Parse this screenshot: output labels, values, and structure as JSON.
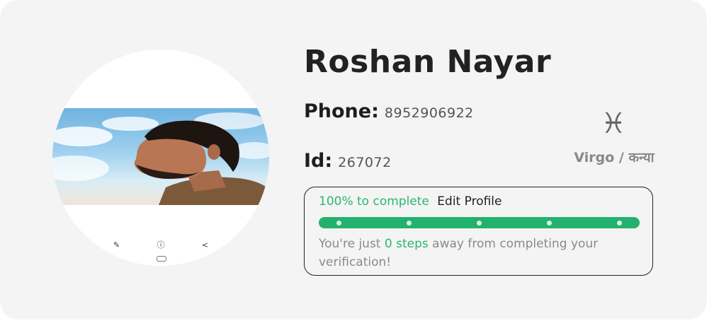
{
  "profile": {
    "name": "Roshan Nayar",
    "phone_label": "Phone:",
    "phone": "8952906922",
    "id_label": "Id:",
    "id": "267072"
  },
  "zodiac": {
    "symbol": "♓",
    "name": "Virgo / कन्या"
  },
  "progress": {
    "percent_text": "100% to complete",
    "edit_label": "Edit Profile",
    "fraction": 1.0,
    "message_prefix": "You're just ",
    "steps_text": "0 steps",
    "message_suffix": " away from completing your verification!",
    "accent_color": "#2bb673"
  },
  "avatar": {
    "viewer_icons": [
      "pencil-icon",
      "info-icon",
      "share-icon"
    ]
  }
}
